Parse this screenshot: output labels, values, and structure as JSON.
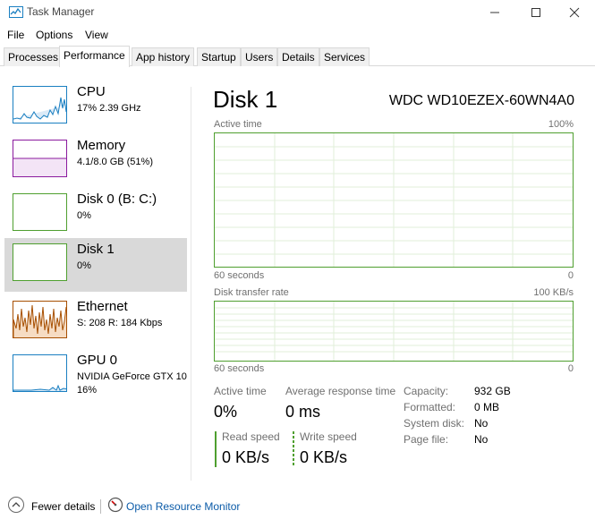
{
  "window": {
    "title": "Task Manager"
  },
  "menu": [
    "File",
    "Options",
    "View"
  ],
  "tabs": [
    "Processes",
    "Performance",
    "App history",
    "Startup",
    "Users",
    "Details",
    "Services"
  ],
  "sidebar": [
    {
      "name": "CPU",
      "value": "17%  2.39 GHz",
      "value2": ""
    },
    {
      "name": "Memory",
      "value": "4.1/8.0 GB (51%)",
      "value2": ""
    },
    {
      "name": "Disk 0 (B: C:)",
      "value": "0%",
      "value2": ""
    },
    {
      "name": "Disk 1",
      "value": "0%",
      "value2": ""
    },
    {
      "name": "Ethernet",
      "value": "S: 208  R: 184 Kbps",
      "value2": ""
    },
    {
      "name": "GPU 0",
      "value": "NVIDIA GeForce GTX 10(",
      "value2": "16%"
    }
  ],
  "main": {
    "title": "Disk 1",
    "model": "WDC WD10EZEX-60WN4A0",
    "graph1": {
      "label": "Active time",
      "max": "100%",
      "time": "60 seconds",
      "min": "0"
    },
    "graph2": {
      "label": "Disk transfer rate",
      "max": "100 KB/s",
      "time": "60 seconds",
      "min": "0"
    },
    "stats": {
      "active_time_label": "Active time",
      "active_time_value": "0%",
      "avg_response_label": "Average response time",
      "avg_response_value": "0 ms",
      "read_label": "Read speed",
      "read_value": "0 KB/s",
      "write_label": "Write speed",
      "write_value": "0 KB/s"
    },
    "props": [
      {
        "label": "Capacity:",
        "value": "932 GB"
      },
      {
        "label": "Formatted:",
        "value": "0 MB"
      },
      {
        "label": "System disk:",
        "value": "No"
      },
      {
        "label": "Page file:",
        "value": "No"
      }
    ]
  },
  "footer": {
    "fewer_details": "Fewer details",
    "open_resource_monitor": "Open Resource Monitor"
  },
  "colors": {
    "disk_green": "#4f9f2f",
    "cpu_blue": "#1a7fc1",
    "memory_purple": "#8b1a9e",
    "ethernet_orange": "#a74f01",
    "link_blue": "#0b5ba8"
  }
}
